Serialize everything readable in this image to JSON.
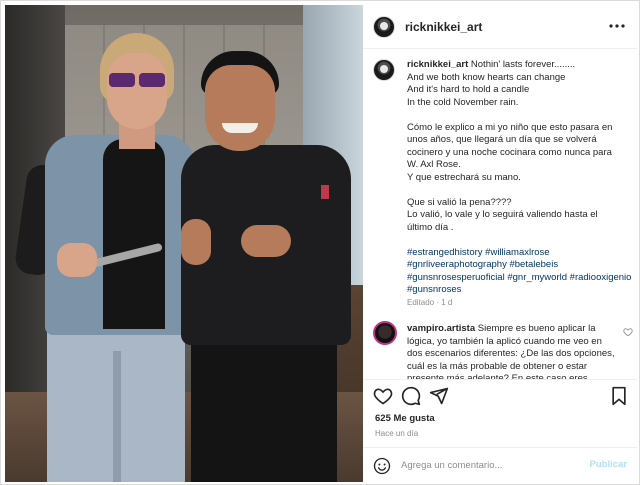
{
  "post": {
    "username": "ricknikkei_art",
    "caption": {
      "username": "ricknikkei_art",
      "lines": [
        "Nothin' lasts forever........",
        "And we both know hearts can change",
        "And it's hard to hold a candle",
        "In the cold November rain."
      ],
      "paragraph2": [
        "Cómo le explico a mi yo niño que esto pasara en",
        "unos años, que llegará un día que se volverá",
        "cocinero y una noche cocinara como nunca para",
        "W. Axl Rose.",
        "Y que estrechará su mano."
      ],
      "paragraph3": [
        "Que si valió la pena????",
        "Lo valió, lo vale y lo seguirá valiendo hasta el",
        "último día ."
      ],
      "hashtags": [
        "#estrangedhistory",
        "#williamaxlrose",
        "#gnrliveeraphotography",
        "#betalebeis",
        "#gunsnrosesperuoficial",
        "#gnr_myworld",
        "#radiooxigenio",
        "#gunsnroses"
      ],
      "meta": "Editado · 1 d"
    },
    "comment": {
      "username": "vampiro.artista",
      "text": "Siempre es bueno aplicar la lógica, yo también la aplicó cuando me veo en dos escenarios diferentes: ¿De las dos opciones, cuál es la más probable de obtener o estar presente más adelante? En este caso eres chef..."
    },
    "likes": "625 Me gusta",
    "time": "Hace un día",
    "composer": {
      "placeholder": "Agrega un comentario...",
      "post_label": "Publicar"
    }
  },
  "icons": {
    "more": "more-options-icon",
    "like": "heart-icon",
    "comment": "comment-icon",
    "share": "send-icon",
    "save": "bookmark-icon",
    "emoji": "emoji-icon"
  },
  "colors": {
    "text": "#262626",
    "muted": "#8e8e8e",
    "link": "#00376b",
    "post_button": "#b2dffc"
  }
}
